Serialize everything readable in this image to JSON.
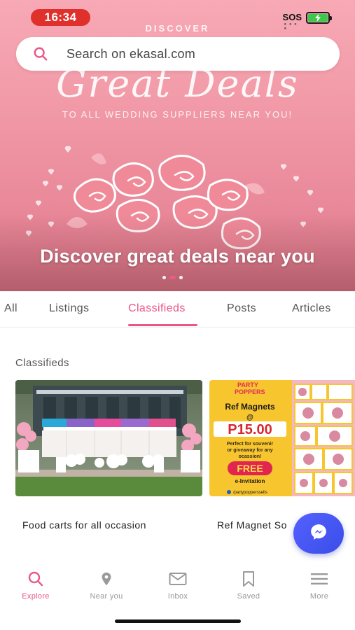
{
  "status": {
    "time": "16:34",
    "sos": "SOS"
  },
  "hero": {
    "top_label": "DISCOVER",
    "headline": "Great Deals",
    "subline": "TO ALL WEDDING SUPPLIERS NEAR YOU!",
    "caption": "Discover great deals near you",
    "slide_count": 3,
    "active_slide": 2
  },
  "search": {
    "placeholder": "Search on ekasal.com"
  },
  "tabs": [
    {
      "label": "All"
    },
    {
      "label": "Listings"
    },
    {
      "label": "Classifieds",
      "active": true
    },
    {
      "label": "Posts"
    },
    {
      "label": "Articles"
    }
  ],
  "section": {
    "title": "Classifieds"
  },
  "cards": [
    {
      "title": "Food carts for all occasion",
      "image": "food-carts-photo"
    },
    {
      "title": "Ref Magnet So",
      "image": "party-poppers-flyer",
      "flyer": {
        "brand_line1": "PARTY",
        "brand_line2": "POPPERS",
        "heading": "Ref Magnets",
        "at": "@",
        "price": "P15.00",
        "tagline_1": "Perfect for souvenir",
        "tagline_2": "or giveaway for any",
        "tagline_3": "ocassion!",
        "free": "FREE",
        "free_sub": "e-Invitation",
        "handle": "/partypopperssells"
      }
    }
  ],
  "bottom_nav": [
    {
      "label": "Explore",
      "icon": "search-icon",
      "active": true
    },
    {
      "label": "Near you",
      "icon": "location-pin-icon"
    },
    {
      "label": "Inbox",
      "icon": "envelope-icon"
    },
    {
      "label": "Saved",
      "icon": "bookmark-icon"
    },
    {
      "label": "More",
      "icon": "hamburger-menu-icon"
    }
  ],
  "colors": {
    "accent": "#e95687",
    "hero_pink": "#f29aa8",
    "status_red": "#e0302b",
    "fab_blue": "#4a57f5",
    "battery_green": "#3fc64c",
    "flyer_yellow": "#f7c62f"
  }
}
